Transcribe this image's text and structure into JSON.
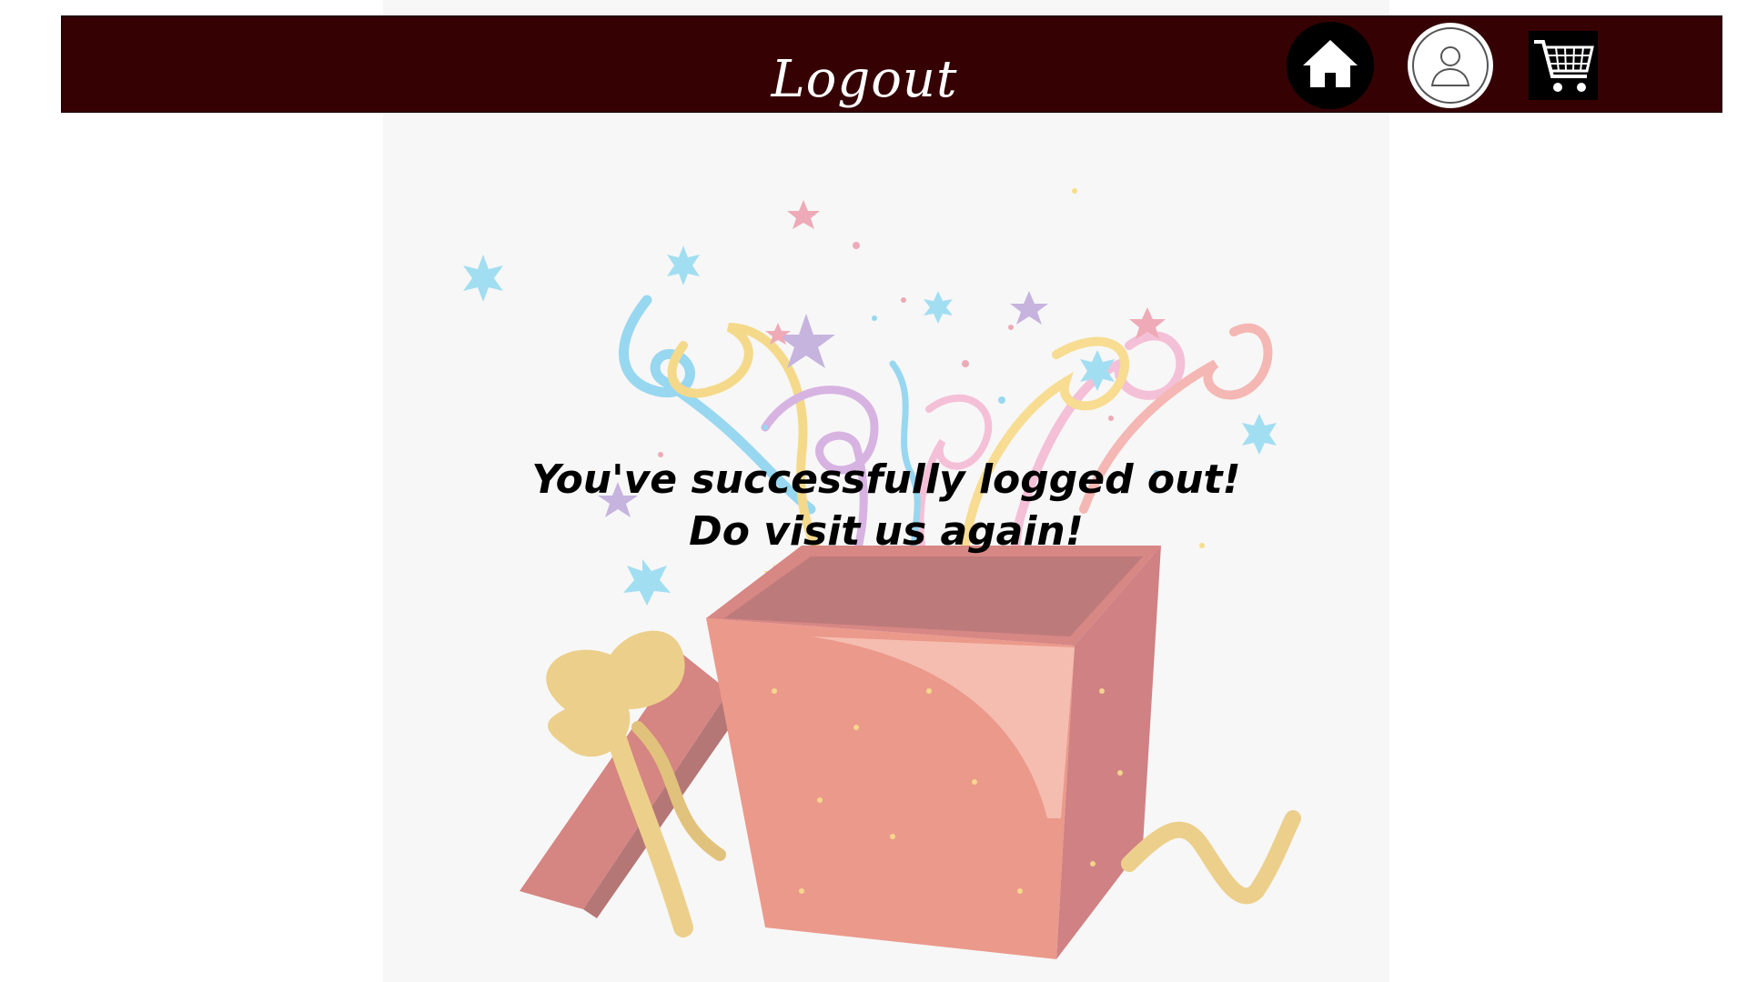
{
  "header": {
    "title": "Logout",
    "background_color": "#350103",
    "icons": {
      "home": "home-icon",
      "profile": "user-profile-icon",
      "cart": "shopping-cart-icon"
    }
  },
  "main": {
    "message_line1": "You've successfully logged out!",
    "message_line2": "Do visit us again!",
    "illustration": "open-gift-box-with-confetti-illustration"
  }
}
